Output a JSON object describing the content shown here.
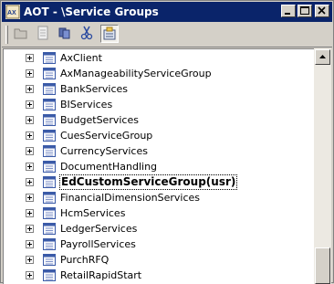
{
  "window": {
    "title": "AOT - \\Service Groups"
  },
  "title_buttons": [
    "minimize",
    "maximize",
    "close"
  ],
  "toolbar": {
    "tools": [
      "open-icon",
      "properties-icon",
      "compile-icon",
      "cut-icon",
      "import-icon"
    ]
  },
  "tree": {
    "items": [
      {
        "label": "AxClient",
        "selected": false
      },
      {
        "label": "AxManageabilityServiceGroup",
        "selected": false
      },
      {
        "label": "BankServices",
        "selected": false
      },
      {
        "label": "BIServices",
        "selected": false
      },
      {
        "label": "BudgetServices",
        "selected": false
      },
      {
        "label": "CuesServiceGroup",
        "selected": false
      },
      {
        "label": "CurrencyServices",
        "selected": false
      },
      {
        "label": "DocumentHandling",
        "selected": false
      },
      {
        "label": "EdCustomServiceGroup(usr)",
        "selected": true
      },
      {
        "label": "FinancialDimensionServices",
        "selected": false
      },
      {
        "label": "HcmServices",
        "selected": false
      },
      {
        "label": "LedgerServices",
        "selected": false
      },
      {
        "label": "PayrollServices",
        "selected": false
      },
      {
        "label": "PurchRFQ",
        "selected": false
      },
      {
        "label": "RetailRapidStart",
        "selected": false
      }
    ]
  },
  "colors": {
    "titlebar": "#0a246a",
    "window": "#d4d0c8",
    "tree_bg": "#ffffff"
  }
}
